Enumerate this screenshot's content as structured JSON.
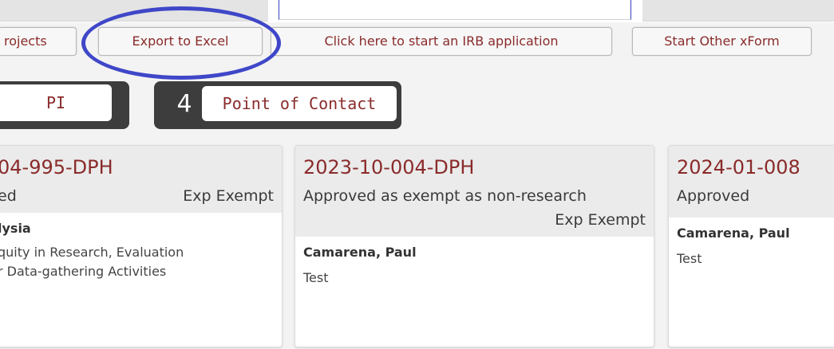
{
  "toolbar": {
    "projects_label": "rojects",
    "export_label": "Export to Excel",
    "irb_label": "Click here to start an IRB application",
    "xform_label": "Start Other xForm"
  },
  "tabs": {
    "pi_label": "PI",
    "poc_count": "4",
    "poc_label": "Point of Contact"
  },
  "cards": [
    {
      "id": "04-995-DPH",
      "status": "ed",
      "exp": "Exp Exempt",
      "name": "lysia",
      "desc_line1": "quity in Research, Evaluation",
      "desc_line2": "r Data-gathering Activities"
    },
    {
      "id": "2023-10-004-DPH",
      "status": "Approved as exempt as non-research",
      "exp": "Exp Exempt",
      "name": "Camarena, Paul",
      "desc": "Test"
    },
    {
      "id": "2024-01-008",
      "status": "Approved",
      "name": "Camarena, Paul",
      "desc": "Test"
    }
  ],
  "colors": {
    "accent_text": "#8a2b2b",
    "annotation_circle": "#3f47c8",
    "tab_dark": "#3d3d3d"
  }
}
